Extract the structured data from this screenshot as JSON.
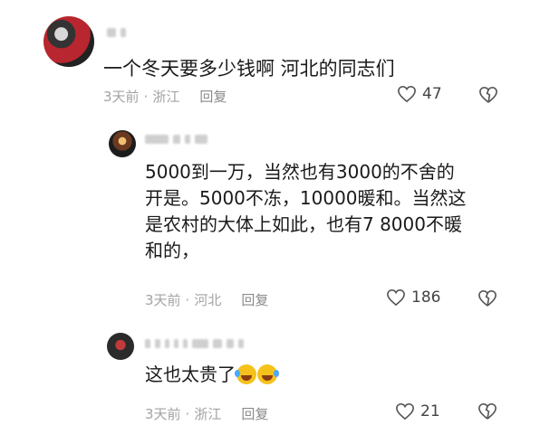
{
  "main_comment": {
    "text": "一个冬天要多少钱啊 河北的同志们",
    "time": "3天前",
    "location": "浙江",
    "reply_label": "回复",
    "likes": "47"
  },
  "replies": [
    {
      "lines": [
        "5000到一万，当然也有3000的不舍的",
        "开是。5000不冻，10000暖和。当然这",
        "是农村的大体上如此，也有7 8000不暖",
        "和的，"
      ],
      "time": "3天前",
      "location": "河北",
      "reply_label": "回复",
      "likes": "186"
    },
    {
      "text": "这也太贵了",
      "emojis": [
        "loudly-crying-laughing-emoji",
        "loudly-crying-laughing-emoji"
      ],
      "time": "3天前",
      "location": "浙江",
      "reply_label": "回复",
      "likes": "21"
    }
  ],
  "icons": {
    "like": "heart-outline-icon",
    "dislike": "broken-heart-icon"
  },
  "colors": {
    "meta": "#a3a3a3",
    "text": "#1a1a1a"
  }
}
